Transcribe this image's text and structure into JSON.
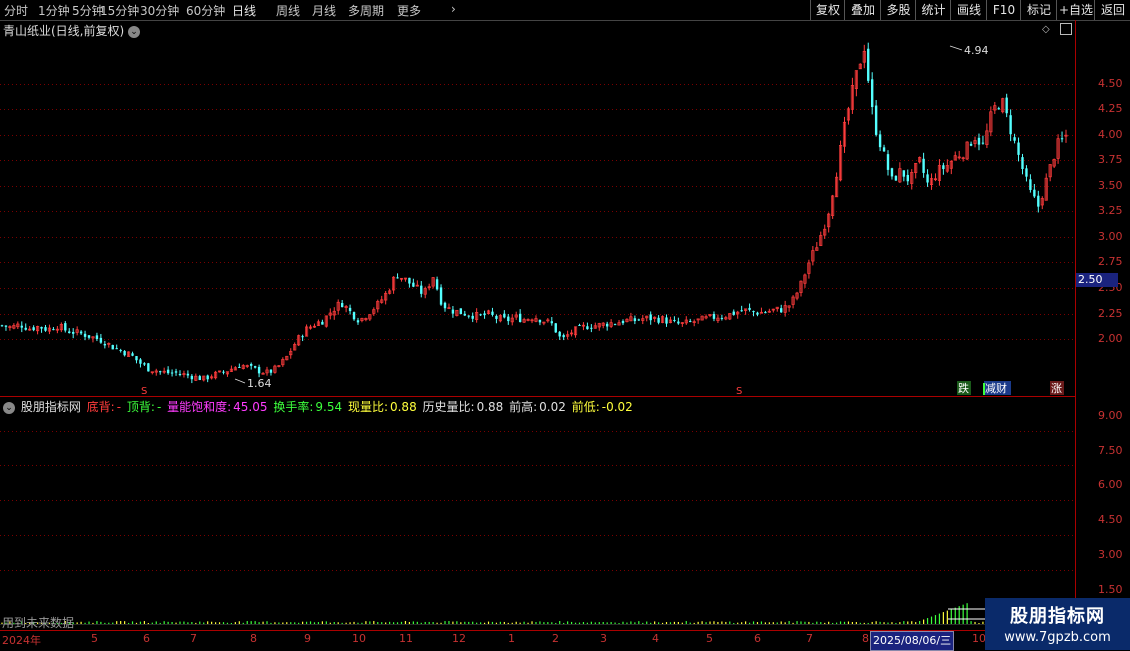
{
  "toolbar": {
    "periods": [
      "分时",
      "1分钟",
      "5分钟",
      "15分钟",
      "30分钟",
      "60分钟",
      "日线",
      "周线",
      "月线",
      "多周期",
      "更多"
    ],
    "active_period": "日线",
    "tools": [
      "复权",
      "叠加",
      "多股",
      "统计",
      "画线",
      "F10",
      "标记",
      "+自选",
      "返回"
    ]
  },
  "title": "青山纸业(日线,前复权)",
  "main_y_ticks": [
    "4.50",
    "4.25",
    "4.00",
    "3.75",
    "3.50",
    "3.25",
    "3.00",
    "2.75",
    "2.50",
    "2.25",
    "2.00"
  ],
  "current_price_tag": "2.50",
  "high_label": "4.94",
  "low_label": "1.64",
  "markers": {
    "s1": "S",
    "s2": "S",
    "die": "跌",
    "jiancai": "减财",
    "zhang": "涨"
  },
  "indicator": {
    "name": "股朋指标网",
    "dibei_label": "底背:",
    "dibei_val": "-",
    "dingbei_label": "顶背:",
    "dingbei_val": "-",
    "lnbhd_label": "量能饱和度:",
    "lnbhd_val": "45.05",
    "hsl_label": "换手率:",
    "hsl_val": "9.54",
    "xlb_label": "现量比:",
    "xlb_val": "0.88",
    "lslb_label": "历史量比:",
    "lslb_val": "0.88",
    "qg_label": "前高:",
    "qg_val": "0.02",
    "qd_label": "前低:",
    "qd_val": "-0.02"
  },
  "sub_y_ticks": [
    "9.00",
    "7.50",
    "6.00",
    "4.50",
    "3.00",
    "1.50"
  ],
  "future_note": "用到未来数据",
  "x_axis": [
    "2024年",
    "5",
    "6",
    "7",
    "8",
    "9",
    "10",
    "11",
    "12",
    "1",
    "2",
    "3",
    "4",
    "5",
    "6",
    "7",
    "8"
  ],
  "date_highlight": "2025/08/06/三",
  "x_axis_end": "10",
  "watermark": {
    "title": "股朋指标网",
    "url": "www.7gpzb.com"
  },
  "colors": {
    "up": "#ff3c3c",
    "down": "#54ffff",
    "grid": "#7a0000",
    "axis": "#c83232"
  },
  "chart_data": {
    "type": "candlestick",
    "title": "青山纸业(日线,前复权)",
    "ylim": [
      1.6,
      5.0
    ],
    "x_labels": [
      "2024年",
      "5",
      "6",
      "7",
      "8",
      "9",
      "10",
      "11",
      "12",
      "1",
      "2",
      "3",
      "4",
      "5",
      "6",
      "7",
      "8"
    ],
    "close_path": [
      2.17,
      2.15,
      2.18,
      2.14,
      2.16,
      2.13,
      2.17,
      2.12,
      2.1,
      2.08,
      2.05,
      2.02,
      1.96,
      1.92,
      1.88,
      1.8,
      1.74,
      1.72,
      1.7,
      1.7,
      1.68,
      1.66,
      1.64,
      1.68,
      1.7,
      1.74,
      1.78,
      1.75,
      1.72,
      1.7,
      1.75,
      1.85,
      2.0,
      2.12,
      2.18,
      2.22,
      2.32,
      2.4,
      2.3,
      2.22,
      2.3,
      2.38,
      2.5,
      2.68,
      2.62,
      2.55,
      2.48,
      2.66,
      2.38,
      2.32,
      2.3,
      2.28,
      2.26,
      2.28,
      2.24,
      2.22,
      2.25,
      2.23,
      2.26,
      2.22,
      2.18,
      2.02,
      2.1,
      2.14,
      2.17,
      2.17,
      2.19,
      2.2,
      2.22,
      2.22,
      2.24,
      2.24,
      2.23,
      2.2,
      2.18,
      2.2,
      2.22,
      2.24,
      2.26,
      2.27,
      2.3,
      2.32,
      2.3,
      2.3,
      2.32,
      2.33,
      2.38,
      2.55,
      2.8,
      3.0,
      3.25,
      3.7,
      4.2,
      4.6,
      4.94,
      4.2,
      3.9,
      3.6,
      3.7,
      3.6,
      3.8,
      3.55,
      3.7,
      3.75,
      3.85,
      3.9,
      4.05,
      3.95,
      4.3,
      4.4,
      4.1,
      3.8,
      3.5,
      3.35,
      3.65,
      3.95,
      4.05
    ],
    "volume": {
      "peak_label_val": "9.54"
    }
  }
}
